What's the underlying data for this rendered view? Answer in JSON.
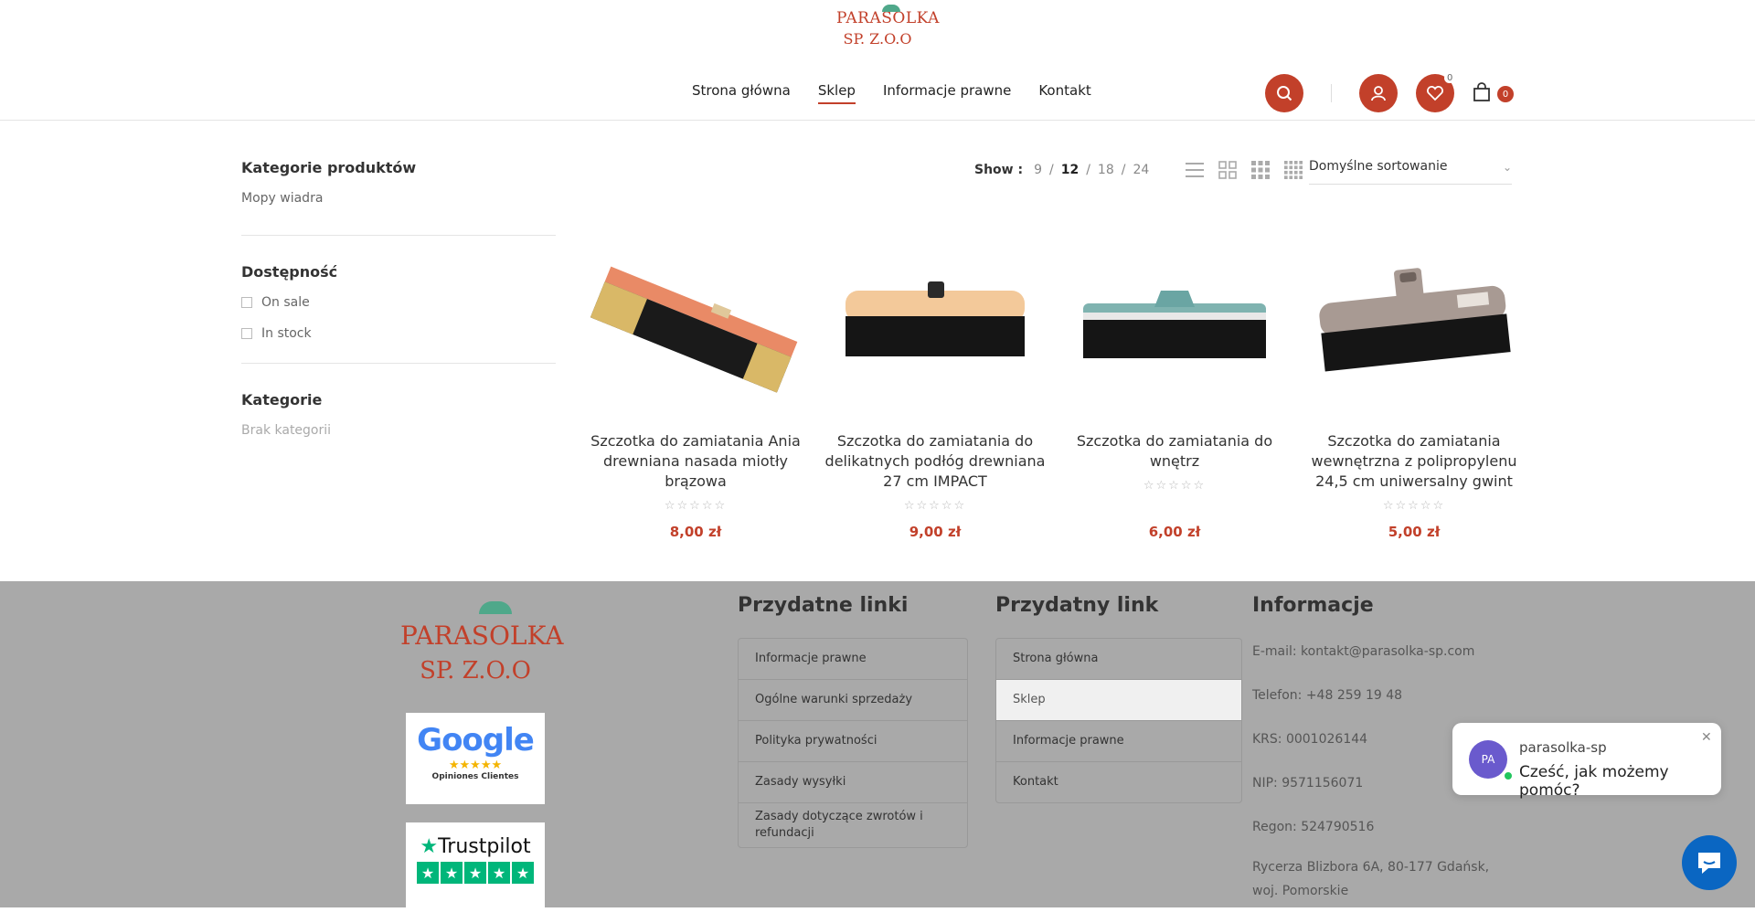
{
  "header": {
    "logo_line1": "PARASOLKA",
    "logo_line2": "SP. Z.O.O",
    "nav": [
      "Strona główna",
      "Sklep",
      "Informacje prawne",
      "Kontakt"
    ],
    "wishlist_count": "0",
    "cart_count": "0",
    "accent_color": "#c2402a"
  },
  "sidebar": {
    "categories_title": "Kategorie produktów",
    "categories": [
      "Mopy wiadra"
    ],
    "availability_title": "Dostępność",
    "availability": [
      "On sale",
      "In stock"
    ],
    "kategorie_title": "Kategorie",
    "kategorie_empty": "Brak kategorii"
  },
  "toolbar": {
    "show_label": "Show :",
    "per_page": [
      "9",
      "12",
      "18",
      "24"
    ],
    "per_page_active": "12",
    "sort_selected": "Domyślne sortowanie"
  },
  "products": [
    {
      "title": "Szczotka do zamiatania Ania drewniana nasada miotły brązowa",
      "price": "8,00 zł",
      "rating": "☆☆☆☆☆"
    },
    {
      "title": "Szczotka do zamiatania do delikatnych podłóg drewniana 27 cm IMPACT",
      "price": "9,00 zł",
      "rating": "☆☆☆☆☆"
    },
    {
      "title": "Szczotka do zamiatania do wnętrz",
      "price": "6,00 zł",
      "rating": "☆☆☆☆☆"
    },
    {
      "title": "Szczotka do zamiatania wewnętrzna z polipropylenu 24,5 cm uniwersalny gwint",
      "price": "5,00 zł",
      "rating": "☆☆☆☆☆"
    }
  ],
  "footer": {
    "logo_line1": "PARASOLKA",
    "logo_line2": "SP. Z.O.O",
    "google_word": "Google",
    "google_stars": "★★★★★",
    "google_sub": "Opiniones Clientes",
    "trustpilot": "Trustpilot",
    "col1_title": "Przydatne linki",
    "col1_links": [
      "Informacje prawne",
      "Ogólne warunki sprzedaży",
      "Polityka prywatności",
      "Zasady wysyłki",
      "Zasady dotyczące zwrotów i refundacji"
    ],
    "col2_title": "Przydatny link",
    "col2_links": [
      "Strona główna",
      "Sklep",
      "Informacje prawne",
      "Kontakt"
    ],
    "col3_title": "Informacje",
    "email": "E-mail: kontakt@parasolka-sp.com",
    "phone": "Telefon: +48 259 19 48",
    "krs": "KRS: 0001026144",
    "nip": "NIP: 9571156071",
    "regon": "Regon: 524790516",
    "address": "Rycerza Blizbora 6A, 80-177 Gdańsk, woj. Pomorskie"
  },
  "chat": {
    "avatar": "PA",
    "name": "parasolka-sp",
    "message": "Cześć, jak możemy pomóc?"
  }
}
